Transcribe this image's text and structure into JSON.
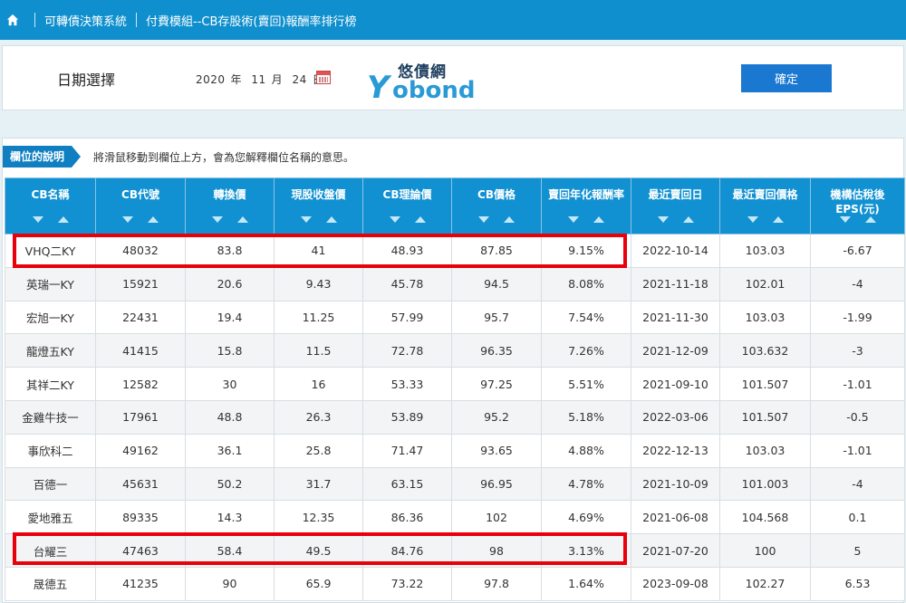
{
  "nav": {
    "home_icon": "home-icon",
    "crumbs": [
      "可轉債決策系統",
      "付費模組--CB存股術(賣回)報酬率排行榜"
    ]
  },
  "date_panel": {
    "label": "日期選擇",
    "year": "2020",
    "year_unit": "年",
    "month": "11",
    "month_unit": "月",
    "day": "24",
    "day_unit": "日",
    "calendar_icon": "calendar-icon",
    "confirm_label": "確定"
  },
  "logo": {
    "cn": "悠債網",
    "y": "Y",
    "bond": "obond"
  },
  "explain": {
    "tag": "欄位的說明",
    "hint": "將滑鼠移動到欄位上方，會為您解釋欄位名稱的意思。"
  },
  "table": {
    "headers": [
      "CB名稱",
      "CB代號",
      "轉換價",
      "現股收盤價",
      "CB理論價",
      "CB價格",
      "賣回年化報酬率",
      "最近賣回日",
      "最近賣回價格",
      "機構估稅後EPS(元)"
    ],
    "rows": [
      [
        "VHQ二KY",
        "48032",
        "83.8",
        "41",
        "48.93",
        "87.85",
        "9.15%",
        "2022-10-14",
        "103.03",
        "-6.67"
      ],
      [
        "英瑞一KY",
        "15921",
        "20.6",
        "9.43",
        "45.78",
        "94.5",
        "8.08%",
        "2021-11-18",
        "102.01",
        "-4"
      ],
      [
        "宏旭一KY",
        "22431",
        "19.4",
        "11.25",
        "57.99",
        "95.7",
        "7.54%",
        "2021-11-30",
        "103.03",
        "-1.99"
      ],
      [
        "龍燈五KY",
        "41415",
        "15.8",
        "11.5",
        "72.78",
        "96.35",
        "7.26%",
        "2021-12-09",
        "103.632",
        "-3"
      ],
      [
        "其祥二KY",
        "12582",
        "30",
        "16",
        "53.33",
        "97.25",
        "5.51%",
        "2021-09-10",
        "101.507",
        "-1.01"
      ],
      [
        "金雞牛技一",
        "17961",
        "48.8",
        "26.3",
        "53.89",
        "95.2",
        "5.18%",
        "2022-03-06",
        "101.507",
        "-0.5"
      ],
      [
        "事欣科二",
        "49162",
        "36.1",
        "25.8",
        "71.47",
        "93.65",
        "4.88%",
        "2022-12-13",
        "103.03",
        "-1.01"
      ],
      [
        "百德一",
        "45631",
        "50.2",
        "31.7",
        "63.15",
        "96.95",
        "4.78%",
        "2021-10-09",
        "101.003",
        "-4"
      ],
      [
        "愛地雅五",
        "89335",
        "14.3",
        "12.35",
        "86.36",
        "102",
        "4.69%",
        "2021-06-08",
        "104.568",
        "0.1"
      ],
      [
        "台耀三",
        "47463",
        "58.4",
        "49.5",
        "84.76",
        "98",
        "3.13%",
        "2021-07-20",
        "100",
        "5"
      ],
      [
        "晟德五",
        "41235",
        "90",
        "65.9",
        "73.22",
        "97.8",
        "1.64%",
        "2023-09-08",
        "102.27",
        "6.53"
      ]
    ]
  },
  "colors": {
    "nav": "#0f8fce",
    "header": "#1191d1",
    "highlight": "#e8000b",
    "button": "#1a78d1"
  }
}
